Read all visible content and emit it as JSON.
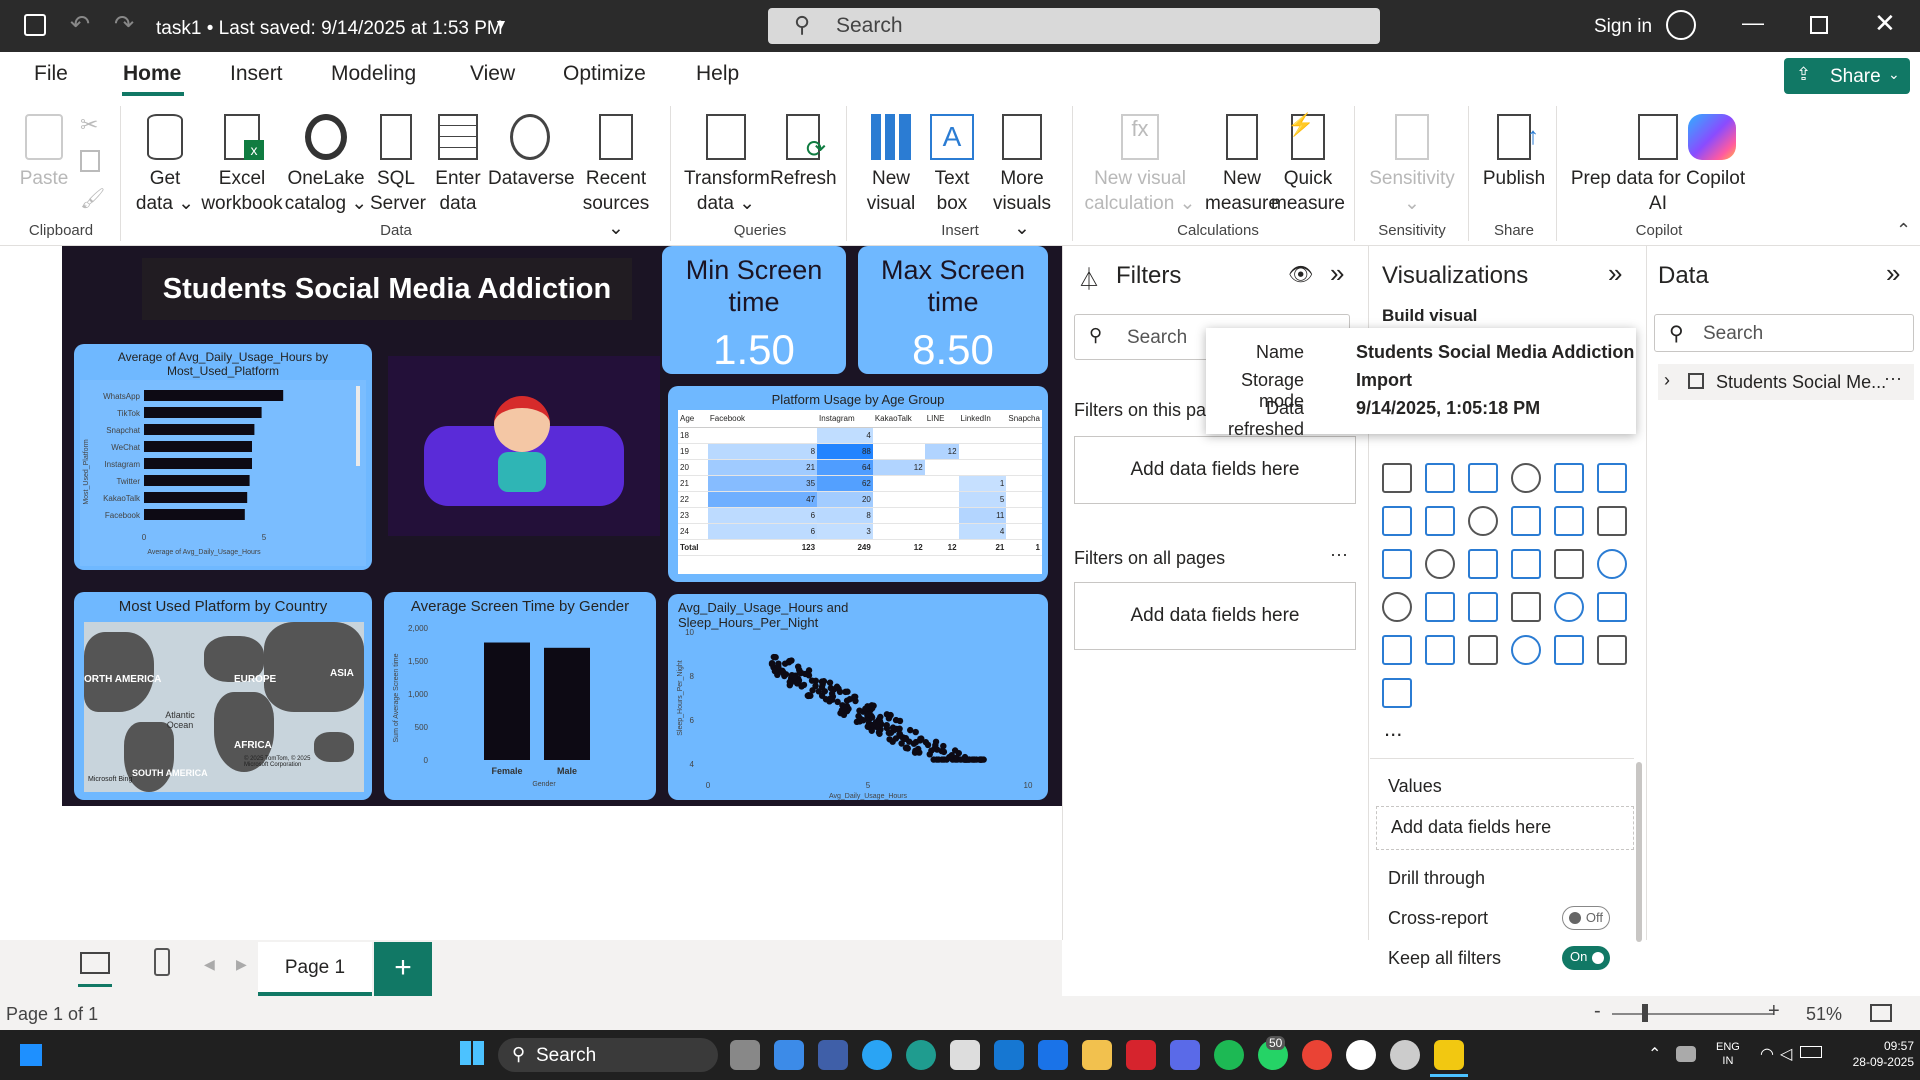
{
  "titlebar": {
    "doc_title": "task1 • Last saved: 9/14/2025 at 1:53 PM",
    "search": "Search",
    "sign_in": "Sign in"
  },
  "menu": [
    "File",
    "Home",
    "Insert",
    "Modeling",
    "View",
    "Optimize",
    "Help"
  ],
  "share_label": "Share",
  "ribbon": {
    "paste": "Paste",
    "get_data": [
      "Get",
      "data ⌄"
    ],
    "excel": [
      "Excel",
      "workbook"
    ],
    "onelake": [
      "OneLake",
      "catalog ⌄"
    ],
    "sql": [
      "SQL",
      "Server"
    ],
    "enter_data": [
      "Enter",
      "data"
    ],
    "dataverse": "Dataverse",
    "recent": [
      "Recent",
      "sources ⌄"
    ],
    "transform": [
      "Transform",
      "data ⌄"
    ],
    "refresh": "Refresh",
    "new_visual": [
      "New",
      "visual"
    ],
    "text_box": [
      "Text",
      "box"
    ],
    "more_visuals": [
      "More",
      "visuals ⌄"
    ],
    "new_visual_calc": [
      "New visual",
      "calculation ⌄"
    ],
    "new_measure": [
      "New",
      "measure"
    ],
    "quick_measure": [
      "Quick",
      "measure"
    ],
    "sensitivity": [
      "Sensitivity",
      "⌄"
    ],
    "publish": "Publish",
    "prep_data": [
      "Prep data for Copilot",
      "AI"
    ],
    "groups": [
      "Clipboard",
      "Data",
      "Queries",
      "Insert",
      "Calculations",
      "Sensitivity",
      "Share",
      "Copilot"
    ]
  },
  "report": {
    "title": "Students Social Media Addiction",
    "min_card": {
      "label": "Min Screen time",
      "value": "1.50"
    },
    "max_card": {
      "label": "Max Screen time",
      "value": "8.50"
    },
    "bar_title": "Average of Avg_Daily_Usage_Hours by Most_Used_Platform",
    "map_title": "Most Used Platform by Country",
    "gender_title": "Average Screen Time by Gender",
    "scatter_title": "Avg_Daily_Usage_Hours and Sleep_Hours_Per_Night",
    "matrix_title": "Platform Usage by Age Group",
    "map_labels": [
      "ORTH AMERICA",
      "EUROPE",
      "ASIA",
      "Atlantic Ocean",
      "AFRICA",
      "SOUTH AMERICA",
      "© 2025 TomTom, © 2025 Microsoft Corporation",
      "Microsoft Bing"
    ]
  },
  "chart_data": [
    {
      "type": "bar",
      "title": "Average of Avg_Daily_Usage_Hours by Most_Used_Platform",
      "categories": [
        "WhatsApp",
        "TikTok",
        "Snapchat",
        "WeChat",
        "Instagram",
        "Twitter",
        "KakaoTalk",
        "Facebook"
      ],
      "values": [
        5.8,
        4.9,
        4.6,
        4.5,
        4.5,
        4.4,
        4.3,
        4.2
      ],
      "xlabel": "Average of Avg_Daily_Usage_Hours",
      "ylabel": "Most_Used_Platform",
      "xticks": [
        "0",
        "5"
      ]
    },
    {
      "type": "bar",
      "title": "Average Screen Time by Gender",
      "categories": [
        "Female",
        "Male"
      ],
      "values": [
        1780,
        1700
      ],
      "xlabel": "Gender",
      "ylabel": "Sum of Average Screen time",
      "yticks": [
        "2,000",
        "1,500",
        "1,000",
        "500",
        "0"
      ],
      "ylim": [
        0,
        2000
      ]
    },
    {
      "type": "scatter",
      "title": "Avg_Daily_Usage_Hours and Sleep_Hours_Per_Night",
      "xlabel": "Avg_Daily_Usage_Hours",
      "ylabel": "Sleep_Hours_Per_Night",
      "xlim": [
        0,
        10
      ],
      "ylim": [
        4,
        10
      ],
      "xticks": [
        "0",
        "5",
        "10"
      ],
      "yticks": [
        "10",
        "8",
        "6",
        "4"
      ]
    },
    {
      "type": "table",
      "title": "Platform Usage by Age Group",
      "columns": [
        "Age",
        "Facebook",
        "Instagram",
        "KakaoTalk",
        "LINE",
        "LinkedIn",
        "Snapcha"
      ],
      "rows": [
        [
          "18",
          "",
          "4",
          "",
          "",
          "",
          ""
        ],
        [
          "19",
          "8",
          "88",
          "",
          "12",
          "",
          ""
        ],
        [
          "20",
          "21",
          "64",
          "12",
          "",
          "",
          ""
        ],
        [
          "21",
          "35",
          "62",
          "",
          "",
          "1",
          ""
        ],
        [
          "22",
          "47",
          "20",
          "",
          "",
          "5",
          ""
        ],
        [
          "23",
          "6",
          "8",
          "",
          "",
          "11",
          ""
        ],
        [
          "24",
          "6",
          "3",
          "",
          "",
          "4",
          ""
        ],
        [
          "Total",
          "123",
          "249",
          "12",
          "12",
          "21",
          "1"
        ]
      ]
    }
  ],
  "filters": {
    "title": "Filters",
    "search": "Search",
    "this_page": "Filters on this pa",
    "add1": "Add data fields here",
    "all_pages": "Filters on all pages",
    "add2": "Add data fields here"
  },
  "tooltip": {
    "name_label": "Name",
    "name_value": "Students Social Media Addiction",
    "storage_label": "Storage mode",
    "storage_value": "Import",
    "refreshed_label": "Data refreshed",
    "refreshed_value": "9/14/2025, 1:05:18 PM"
  },
  "viz": {
    "title": "Visualizations",
    "build": "Build visual",
    "values": "Values",
    "add": "Add data fields here",
    "drill": "Drill through",
    "cross": "Cross-report",
    "cross_state": "Off",
    "keep": "Keep all filters",
    "keep_state": "On",
    "more": "..."
  },
  "data_pane": {
    "title": "Data",
    "search": "Search",
    "table": "Students Social Me..."
  },
  "pages": {
    "tab": "Page 1",
    "add": "+"
  },
  "status": {
    "page": "Page 1 of 1",
    "zoom": "51%"
  },
  "taskbar": {
    "search": "Search",
    "lang1": "ENG",
    "lang2": "IN",
    "time": "09:57",
    "date": "28-09-2025",
    "badge": "50"
  },
  "colors": {
    "accent": "#117865",
    "card": "#6fb8ff",
    "report_bg": "#1b1424"
  }
}
